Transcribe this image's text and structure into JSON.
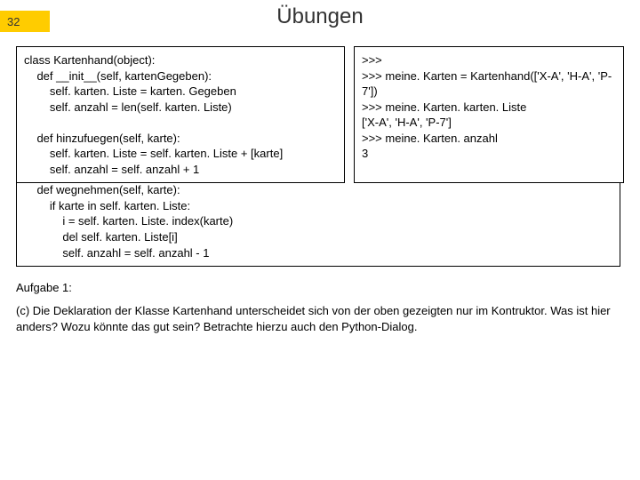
{
  "header": {
    "page_number": "32",
    "title": "Übungen"
  },
  "code_left": "class Kartenhand(object):\n    def __init__(self, kartenGegeben):\n        self. karten. Liste = karten. Gegeben\n        self. anzahl = len(self. karten. Liste)\n\n    def hinzufuegen(self, karte):\n        self. karten. Liste = self. karten. Liste + [karte]\n        self. anzahl = self. anzahl + 1",
  "code_lower": "    def wegnehmen(self, karte):\n        if karte in self. karten. Liste:\n            i = self. karten. Liste. index(karte)\n            del self. karten. Liste[i]\n            self. anzahl = self. anzahl - 1",
  "code_right": ">>>\n>>> meine. Karten = Kartenhand(['X-A', 'H-A', 'P-7'])\n>>> meine. Karten. karten. Liste\n['X-A', 'H-A', 'P-7']\n>>> meine. Karten. anzahl\n3",
  "task": {
    "label": "Aufgabe 1:",
    "text": "(c) Die Deklaration der Klasse Kartenhand unterscheidet sich von der oben gezeigten nur im Kontruktor. Was ist hier anders? Wozu könnte das gut sein? Betrachte hierzu auch den Python-Dialog."
  }
}
